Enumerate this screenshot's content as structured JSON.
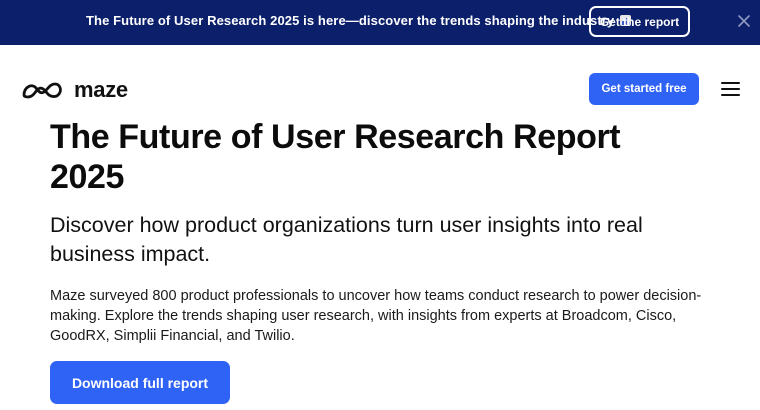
{
  "banner": {
    "text": "The Future of User Research 2025 is here—discover the trends shaping the industry",
    "emoji_icon": "bar-chart-icon",
    "button_label": "Get the report",
    "close_icon": "close-icon"
  },
  "nav": {
    "logo_icon": "maze-logo-icon",
    "logo_text": "maze",
    "cta_label": "Get started free",
    "menu_icon": "hamburger-menu-icon"
  },
  "hero": {
    "title": "The Future of User Research Report 2025",
    "subtitle": "Discover how product organizations turn user insights into real business impact.",
    "body": "Maze surveyed 800 product professionals to uncover how teams conduct research to power decision-making. Explore the trends shaping user research, with insights from experts at Broadcom, Cisco, GoodRX, Simplii Financial, and Twilio.",
    "button_label": "Download full report"
  },
  "colors": {
    "banner_bg": "#0b1f6b",
    "accent": "#2f63f5",
    "text": "#111111"
  }
}
